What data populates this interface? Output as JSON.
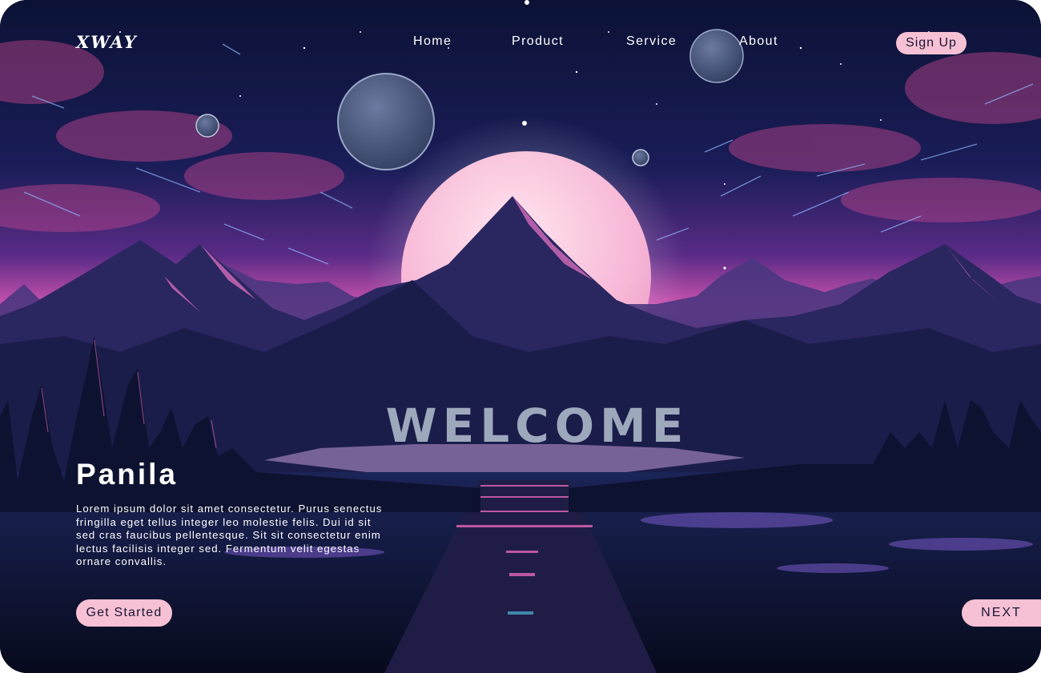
{
  "brand": {
    "logo_text": "XWAY"
  },
  "nav": {
    "items": [
      {
        "label": "Home"
      },
      {
        "label": "Product"
      },
      {
        "label": "Service"
      },
      {
        "label": "About"
      }
    ],
    "signup_label": "Sign Up"
  },
  "hero": {
    "welcome": "WELCOME",
    "title": "Panila",
    "description": "Lorem ipsum dolor sit amet consectetur. Purus senectus fringilla eget tellus integer leo molestie felis. Dui id sit sed cras faucibus pellentesque. Sit sit consectetur enim lectus facilisis integer sed. Fermentum velit egestas ornare convallis.",
    "cta_label": "Get Started",
    "next_label": "NEXT"
  },
  "colors": {
    "accent_pink": "#f6c1d4",
    "sky_dark": "#0a0f2c",
    "horizon_magenta": "#e05ab8",
    "moon_pink": "#f7c6dc"
  },
  "illustration": {
    "icons": [
      "mountains",
      "moon",
      "planets",
      "pine-trees",
      "stars",
      "road"
    ]
  }
}
